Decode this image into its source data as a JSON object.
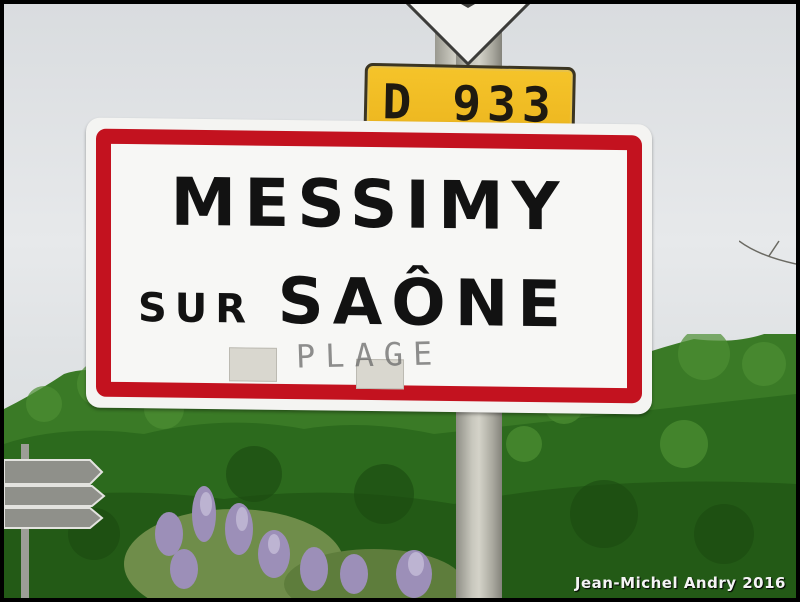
{
  "town_sign": {
    "line1": "MESSIMY",
    "line2_prefix": "SUR",
    "line2_name": "SAÔNE",
    "graffiti": "PLAGE"
  },
  "road_plate": {
    "text": "D 933"
  },
  "watermark": {
    "text": "Jean-Michel Andry 2016"
  },
  "colors": {
    "sign_border": "#c3121f",
    "road_plate_yellow": "#f5c42a",
    "foliage": "#2f6b21",
    "wisteria": "#9c8fb8"
  }
}
